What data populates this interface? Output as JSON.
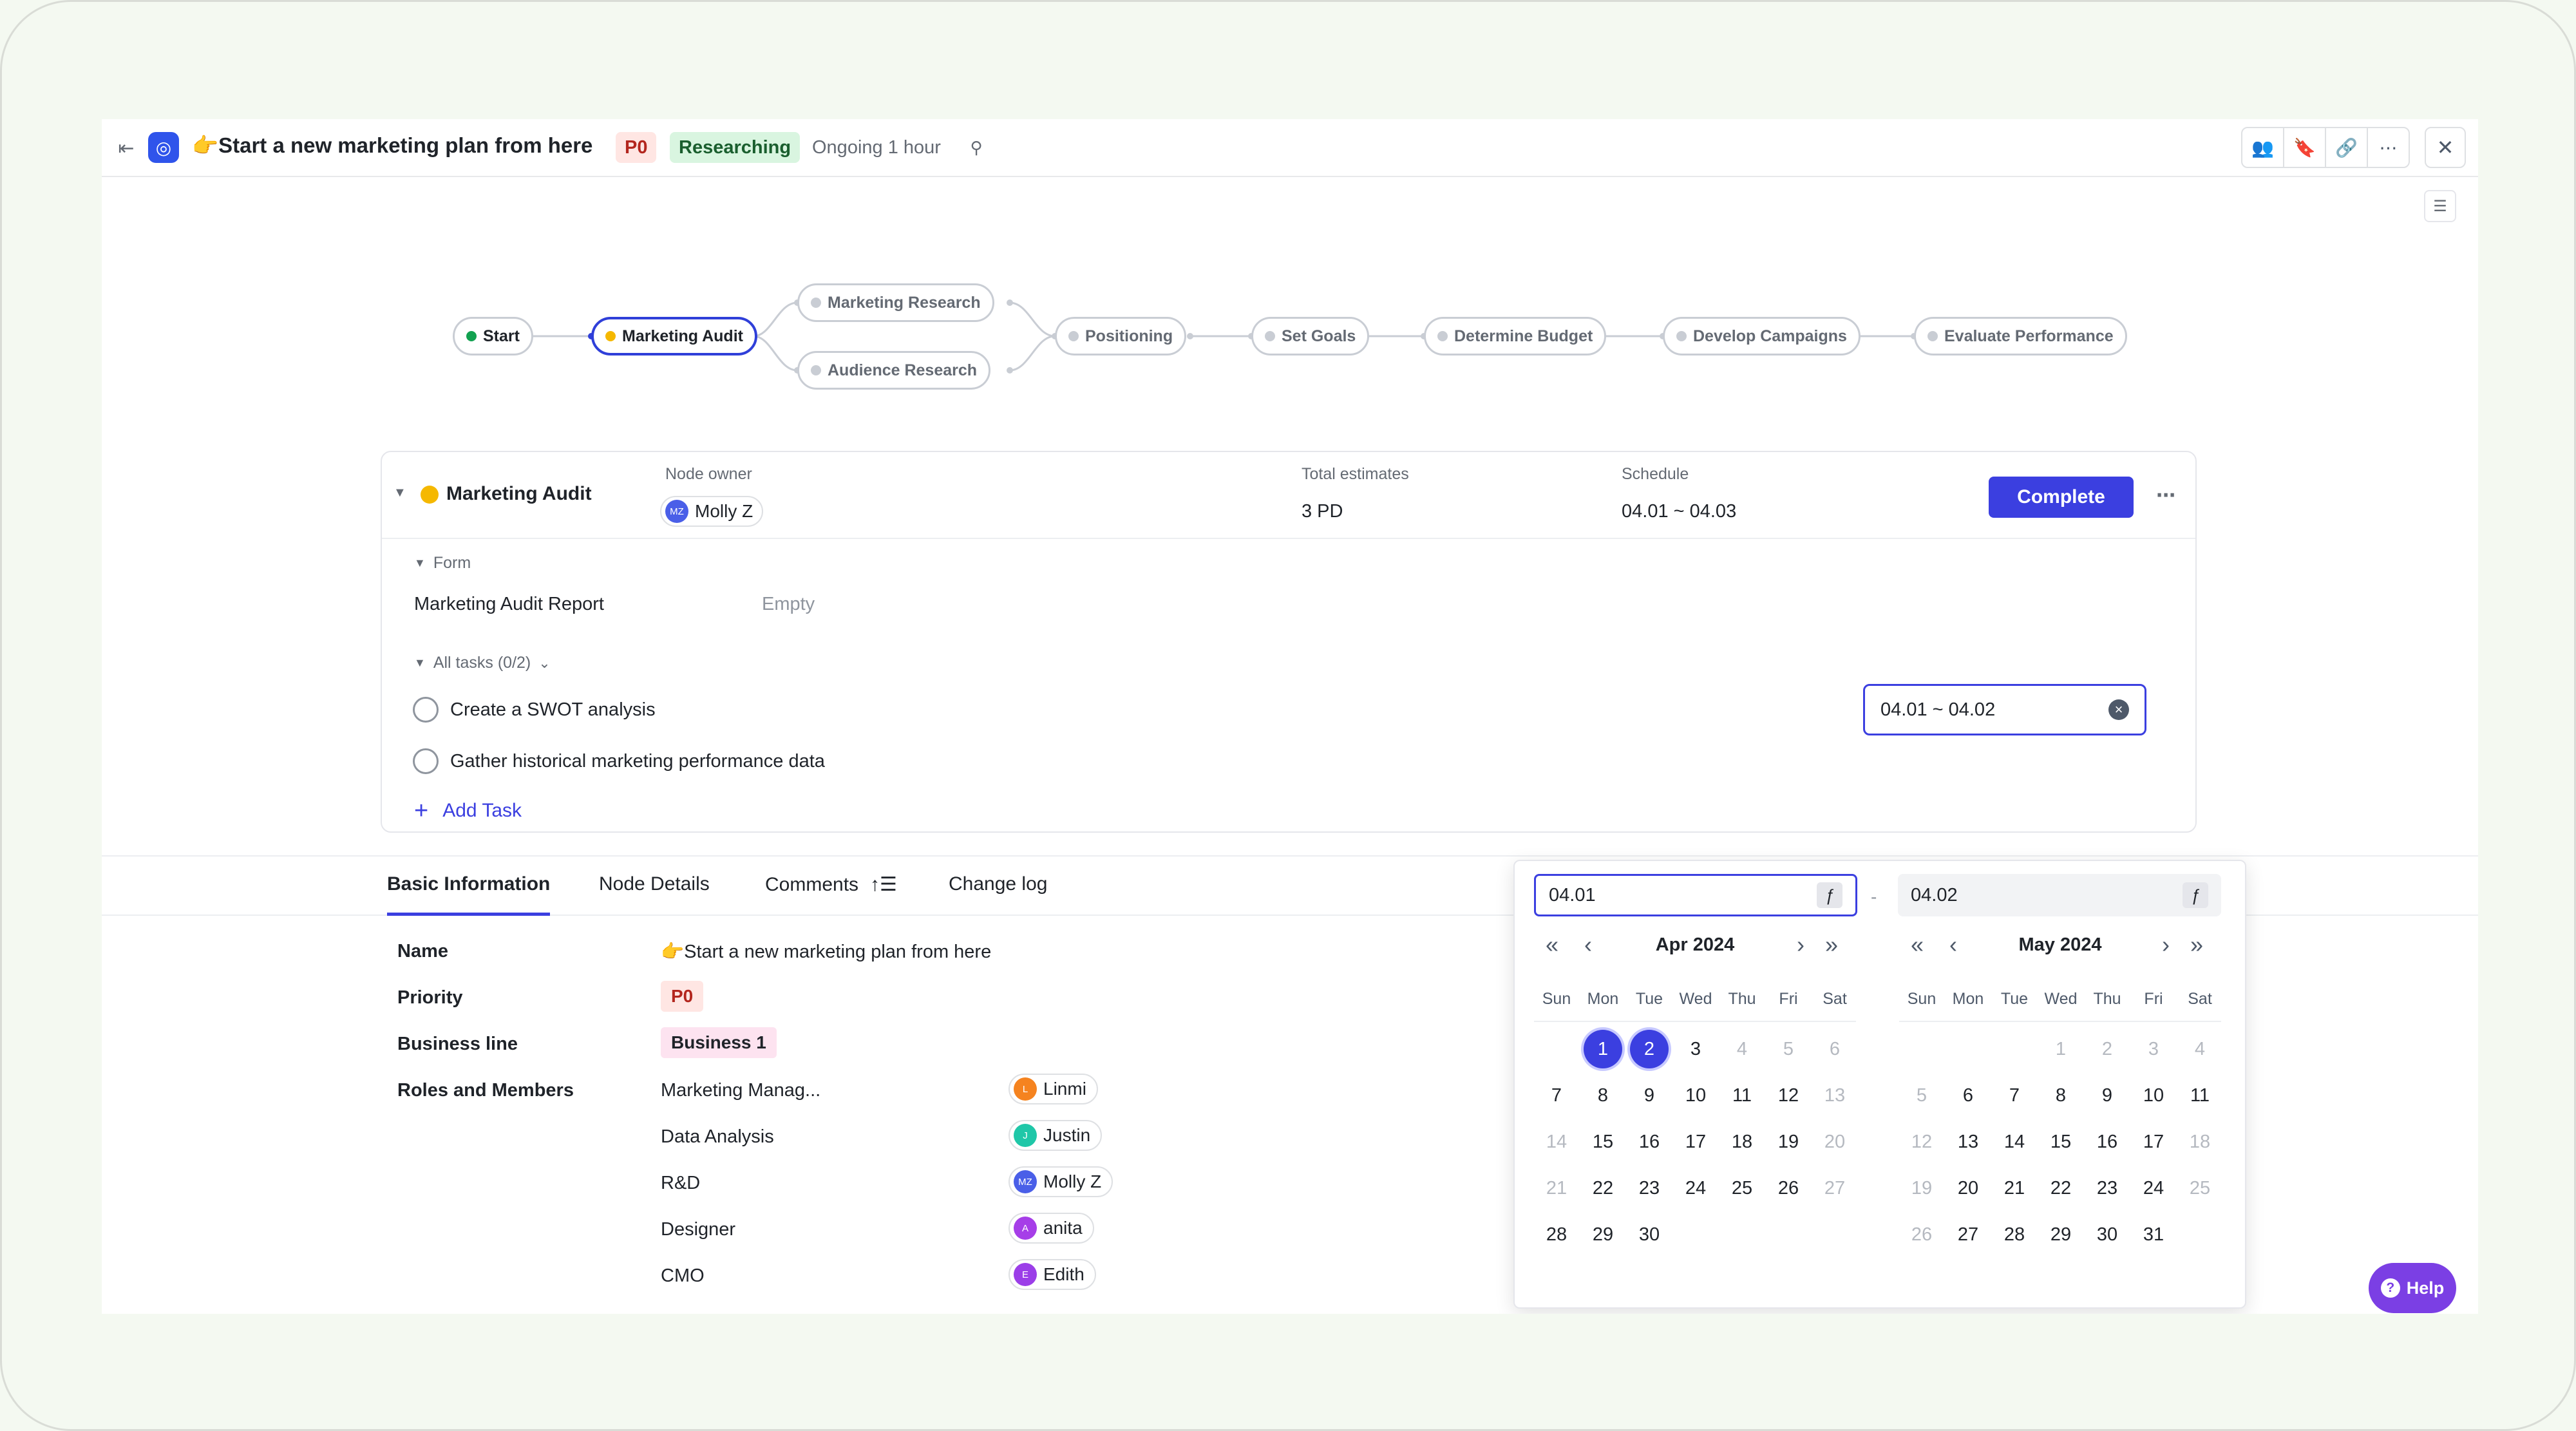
{
  "header": {
    "title": "👉Start a new marketing plan from here",
    "priority": "P0",
    "status": "Researching",
    "ongoing": "Ongoing 1 hour"
  },
  "icons": {
    "sidebar_toggle": "⇤",
    "app": "◎",
    "pin": "⚲",
    "members": "👥",
    "bookmark": "🔖",
    "link": "🔗",
    "more": "⋯",
    "close": "✕",
    "layout": "☰"
  },
  "flow": {
    "nodes": [
      {
        "label": "Start"
      },
      {
        "label": "Marketing Audit"
      },
      {
        "label": "Marketing Research"
      },
      {
        "label": "Audience Research"
      },
      {
        "label": "Positioning"
      },
      {
        "label": "Set Goals"
      },
      {
        "label": "Determine Budget"
      },
      {
        "label": "Develop Campaigns"
      },
      {
        "label": "Evaluate Performance"
      }
    ]
  },
  "node_card": {
    "title": "Marketing Audit",
    "owner_label": "Node owner",
    "owner": {
      "initials": "MZ",
      "name": "Molly Z"
    },
    "estimates_label": "Total estimates",
    "estimates": "3 PD",
    "schedule_label": "Schedule",
    "schedule": "04.01 ~ 04.03",
    "complete_label": "Complete",
    "form_label": "Form",
    "report_label": "Marketing Audit Report",
    "report_value": "Empty",
    "tasks_label": "All tasks (0/2)",
    "tasks": [
      {
        "label": "Create a SWOT analysis"
      },
      {
        "label": "Gather historical marketing performance data"
      }
    ],
    "add_task": "Add Task",
    "date_value": "04.01 ~ 04.02"
  },
  "tabs": [
    {
      "label": "Basic Information"
    },
    {
      "label": "Node Details"
    },
    {
      "label": "Comments"
    },
    {
      "label": "Change log"
    }
  ],
  "basic_info": {
    "name_label": "Name",
    "name_value": "👉Start a new marketing plan from here",
    "priority_label": "Priority",
    "priority_value": "P0",
    "business_label": "Business line",
    "business_value": "Business 1",
    "roles_label": "Roles and Members",
    "roles": [
      {
        "role": "Marketing Manag...",
        "initial": "L",
        "member": "Linmi",
        "color": "#f5831f"
      },
      {
        "role": "Data Analysis",
        "initial": "J",
        "member": "Justin",
        "color": "#1fc7a8"
      },
      {
        "role": "R&D",
        "initial": "MZ",
        "member": "Molly Z",
        "color": "#4a5fe8"
      },
      {
        "role": "Designer",
        "initial": "A",
        "member": "anita",
        "color": "#a63ee8"
      },
      {
        "role": "CMO",
        "initial": "E",
        "member": "Edith",
        "color": "#9b3ee8"
      }
    ]
  },
  "picker": {
    "start_value": "04.01",
    "end_value": "04.02",
    "fx": "ƒ",
    "separator": "-",
    "weekdays": [
      "Sun",
      "Mon",
      "Tue",
      "Wed",
      "Thu",
      "Fri",
      "Sat"
    ],
    "calendars": [
      {
        "month": "Apr 2024",
        "weeks": [
          [
            "",
            "1",
            "2",
            "3",
            "4",
            "5",
            "6"
          ],
          [
            "7",
            "8",
            "9",
            "10",
            "11",
            "12",
            "13"
          ],
          [
            "14",
            "15",
            "16",
            "17",
            "18",
            "19",
            "20"
          ],
          [
            "21",
            "22",
            "23",
            "24",
            "25",
            "26",
            "27"
          ],
          [
            "28",
            "29",
            "30",
            "",
            "",
            "",
            ""
          ]
        ],
        "muted": [
          "4",
          "5",
          "6",
          "13",
          "14",
          "20",
          "21",
          "27"
        ],
        "selected": [
          "1",
          "2"
        ]
      },
      {
        "month": "May 2024",
        "weeks": [
          [
            "",
            "",
            "",
            "1",
            "2",
            "3",
            "4"
          ],
          [
            "5",
            "6",
            "7",
            "8",
            "9",
            "10",
            "11"
          ],
          [
            "12",
            "13",
            "14",
            "15",
            "16",
            "17",
            "18"
          ],
          [
            "19",
            "20",
            "21",
            "22",
            "23",
            "24",
            "25"
          ],
          [
            "26",
            "27",
            "28",
            "29",
            "30",
            "31",
            ""
          ]
        ],
        "muted": [
          "1",
          "2",
          "3",
          "4",
          "5",
          "12",
          "18",
          "19",
          "25",
          "26"
        ],
        "selected": []
      }
    ]
  },
  "help": "Help"
}
